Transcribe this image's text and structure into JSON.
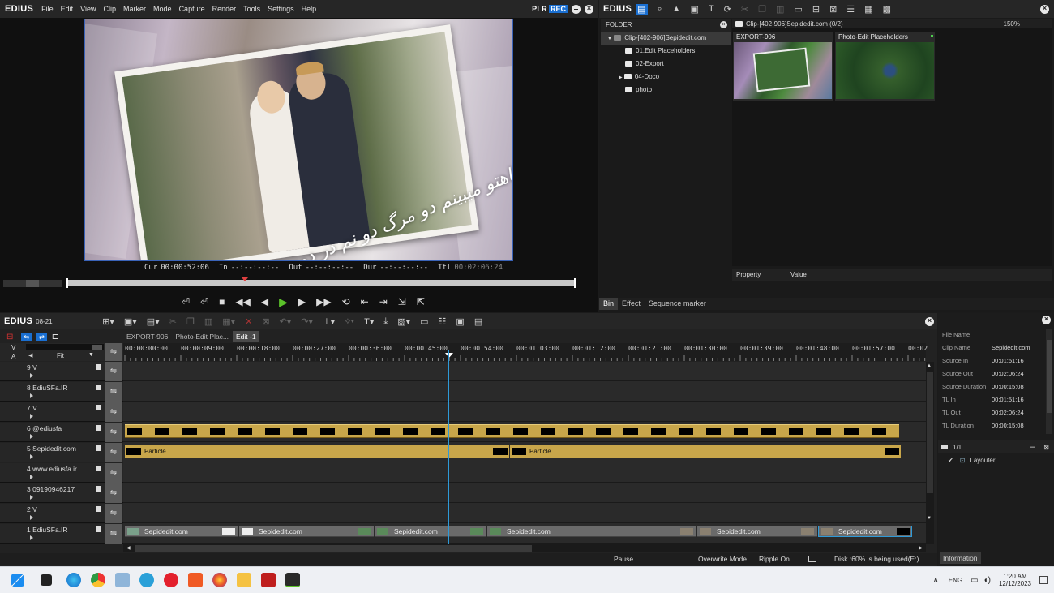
{
  "player": {
    "logo": "EDIUS",
    "menu": [
      "File",
      "Edit",
      "View",
      "Clip",
      "Marker",
      "Mode",
      "Capture",
      "Render",
      "Tools",
      "Settings",
      "Help"
    ],
    "plr": "PLR",
    "rec": "REC",
    "overlay_text": "من هر وقت نگاهتو میبینم دو مرگ دو نم در دوم",
    "timecodes": {
      "cur_label": "Cur",
      "cur": "00:00:52:06",
      "in_label": "In",
      "in": "--:--:--:--",
      "out_label": "Out",
      "out": "--:--:--:--",
      "dur_label": "Dur",
      "dur": "--:--:--:--",
      "ttl_label": "Ttl",
      "ttl": "00:02:06:24"
    },
    "scrub_position": 0.35
  },
  "bin": {
    "logo": "EDIUS",
    "zoom": "150%",
    "folder_header": "FOLDER",
    "tree": [
      {
        "label": "Clip-[402-906]Sepidedit.com",
        "level": 0,
        "expanded": true,
        "selected": true
      },
      {
        "label": "01.Edit Placeholders",
        "level": 1
      },
      {
        "label": "02-Export",
        "level": 1
      },
      {
        "label": "04-Doco",
        "level": 1,
        "collapsed": true
      },
      {
        "label": "photo",
        "level": 1
      }
    ],
    "path": "Clip-[402-906]Sepidedit.com (0/2)",
    "clips": [
      {
        "label": "EXPORT-906"
      },
      {
        "label": "Photo-Edit Placeholders"
      }
    ],
    "property_header": "Property",
    "value_header": "Value",
    "tabs": [
      "Bin",
      "Effect",
      "Sequence marker"
    ]
  },
  "timeline": {
    "logo": "EDIUS",
    "sequence": "08-21",
    "fit_label": "Fit",
    "tabs": [
      "EXPORT-906",
      "Photo-Edit Plac...",
      "Edit -1"
    ],
    "ruler": [
      "00:00:00:00",
      "00:00:09:00",
      "00:00:18:00",
      "00:00:27:00",
      "00:00:36:00",
      "00:00:45:00",
      "00:00:54:00",
      "00:01:03:00",
      "00:01:12:00",
      "00:01:21:00",
      "00:01:30:00",
      "00:01:39:00",
      "00:01:48:00",
      "00:01:57:00",
      "00:02"
    ],
    "tracks": [
      "9 V",
      "8 EdiuSFa.IR",
      "7 V",
      "6 @ediusfa",
      "5 Sepidedit.com",
      "4 www.ediusfa.ir",
      "3 09190946217",
      "2 V",
      "1 EdiuSFa.IR"
    ],
    "particle_label": "Particle",
    "clip_label": "Sepidedit.com",
    "head_v": "V",
    "head_a": "A",
    "status": {
      "pause": "Pause",
      "mode": "Overwrite Mode",
      "ripple": "Ripple On",
      "disk": "Disk :60% is being used(E:)"
    }
  },
  "info": {
    "rows": [
      {
        "key": "File Name",
        "value": ""
      },
      {
        "key": "Clip Name",
        "value": "Sepidedit.com"
      },
      {
        "key": "Source In",
        "value": "00:01:51:16"
      },
      {
        "key": "Source Out",
        "value": "00:02:06:24"
      },
      {
        "key": "Source Duration",
        "value": "00:00:15:08"
      },
      {
        "key": "TL In",
        "value": "00:01:51:16"
      },
      {
        "key": "TL Out",
        "value": "00:02:06:24"
      },
      {
        "key": "TL Duration",
        "value": "00:00:15:08"
      }
    ],
    "page": "1/1",
    "layer": "Layouter",
    "tab": "Information"
  },
  "taskbar": {
    "lang": "ENG",
    "time": "1:20 AM",
    "date": "12/12/2023"
  }
}
